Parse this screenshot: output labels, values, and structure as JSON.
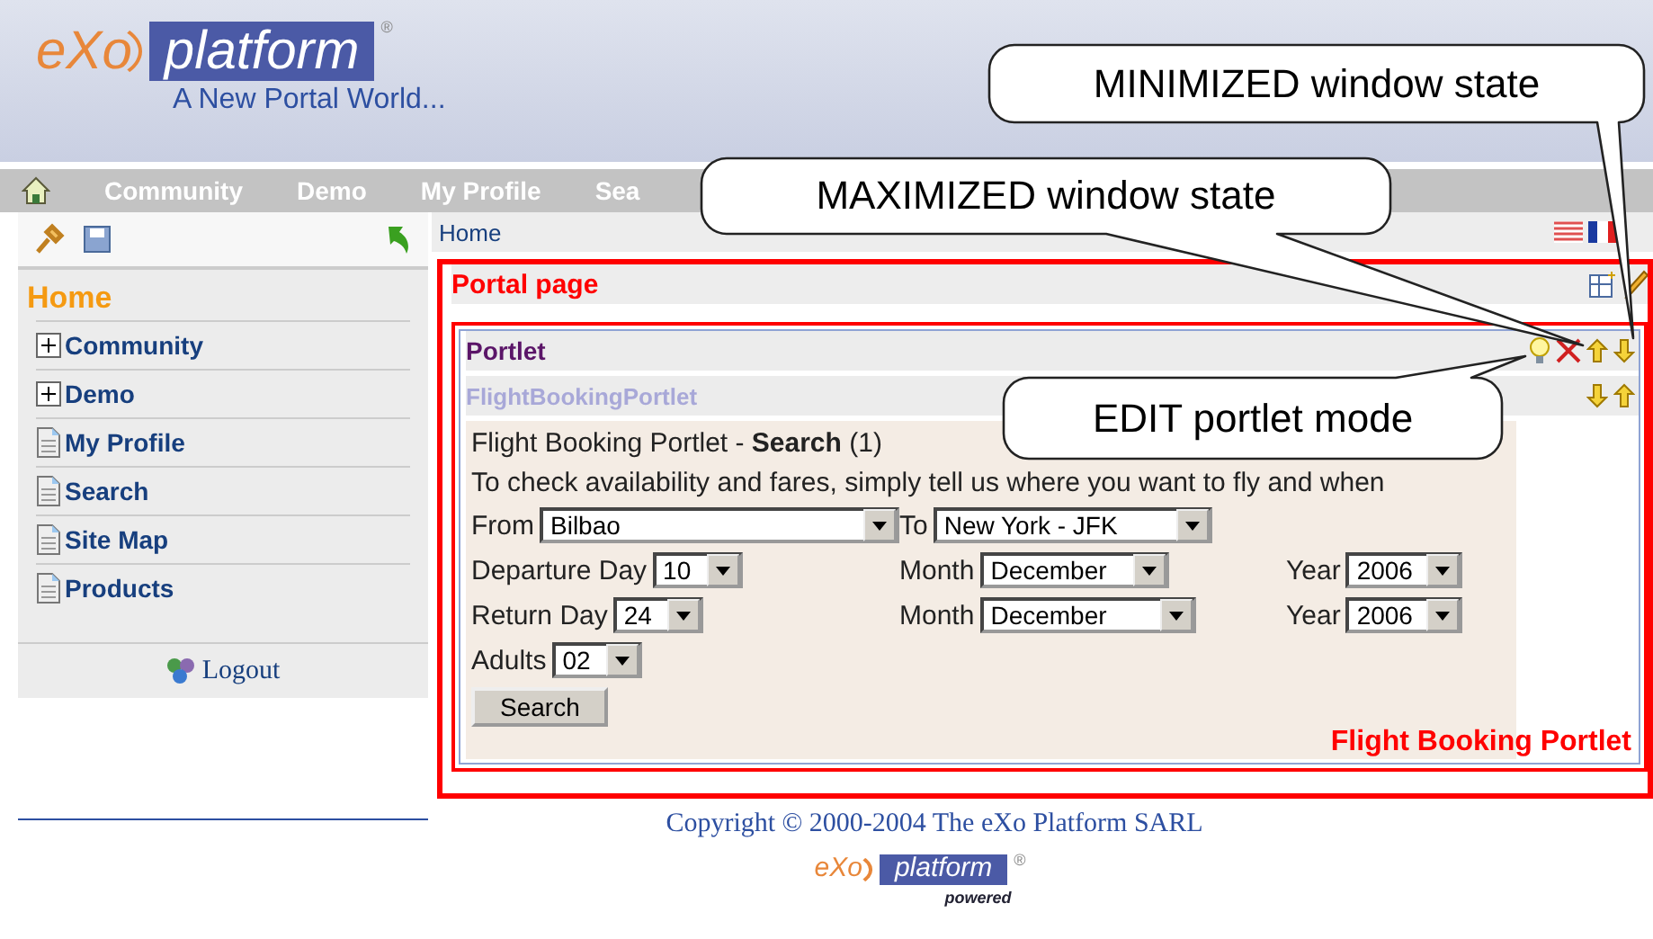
{
  "header": {
    "logo": {
      "mark": "eXo",
      "word": "platform",
      "registered": "®",
      "tagline": "A New Portal World..."
    }
  },
  "nav": {
    "items": [
      {
        "label": "Community"
      },
      {
        "label": "Demo"
      },
      {
        "label": "My Profile"
      },
      {
        "label": "Sea"
      }
    ]
  },
  "sidebar": {
    "title": "Home",
    "items": [
      {
        "label": "Community",
        "kind": "folder"
      },
      {
        "label": "Demo",
        "kind": "folder"
      },
      {
        "label": "My Profile",
        "kind": "page"
      },
      {
        "label": "Search",
        "kind": "page"
      },
      {
        "label": "Site Map",
        "kind": "page"
      },
      {
        "label": "Products",
        "kind": "page"
      }
    ],
    "logout": "Logout"
  },
  "breadcrumb": "Home",
  "page": {
    "title": "Portal page",
    "portlet": {
      "title": "Portlet",
      "name": "FlightBookingPortlet",
      "heading": "Flight Booking Portlet - **Search** (1)",
      "intro": "To check availability and fares, simply tell us where you want to fly and when",
      "rows": [
        [
          {
            "label": "From",
            "value": "Bilbao",
            "kind": "city"
          },
          {
            "label": "To",
            "value": "New York - JFK",
            "kind": "dest"
          }
        ],
        [
          {
            "label": "Departure Day",
            "value": "10",
            "kind": "day"
          },
          {
            "label": "Month",
            "value": "December",
            "kind": "month"
          },
          {
            "label": "Year",
            "value": "2006",
            "kind": "year"
          }
        ],
        [
          {
            "label": "Return Day",
            "value": "24",
            "kind": "day"
          },
          {
            "label": "Month",
            "value": "December",
            "kind": "monthwide"
          },
          {
            "label": "Year",
            "value": "2006",
            "kind": "year"
          }
        ],
        [
          {
            "label": "Adults",
            "value": "02",
            "kind": "day"
          }
        ]
      ],
      "button": "Search",
      "caption": "Flight Booking Portlet"
    }
  },
  "footer": {
    "copyright": "Copyright © 2000-2004 The eXo Platform SARL",
    "logo": {
      "mark": "eXo",
      "word": "platform",
      "registered": "®",
      "tagline": "powered"
    }
  },
  "callouts": [
    {
      "text": "MINIMIZED window state",
      "kind": "minimized"
    },
    {
      "text": "MAXIMIZED window state",
      "kind": "maximized"
    },
    {
      "text": "EDIT portlet mode",
      "kind": "edit"
    }
  ]
}
